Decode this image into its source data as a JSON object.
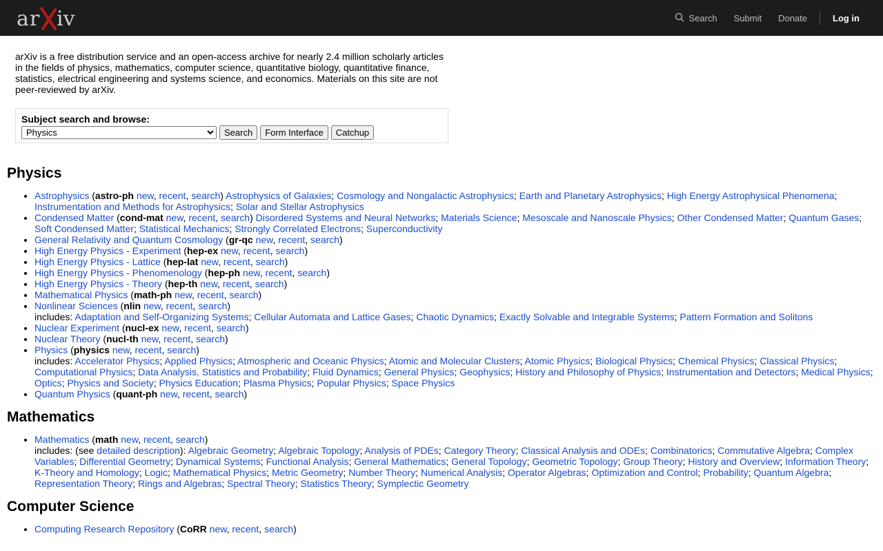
{
  "header": {
    "logo_text": "arXiv",
    "nav": {
      "search": "Search",
      "submit": "Submit",
      "donate": "Donate",
      "login": "Log in"
    }
  },
  "intro": "arXiv is a free distribution service and an open-access archive for nearly 2.4 million scholarly articles in the fields of physics, mathematics, computer science, quantitative biology, quantitative finance, statistics, electrical engineering and systems science, and economics. Materials on this site are not peer-reviewed by arXiv.",
  "search_box": {
    "label": "Subject search and browse:",
    "selected": "Physics",
    "buttons": {
      "search": "Search",
      "form": "Form Interface",
      "catchup": "Catchup"
    }
  },
  "common": {
    "new": "new",
    "recent": "recent",
    "search": "search",
    "includes": "includes: ",
    "see": "(see ",
    "detailed": "detailed description",
    "close_paren": "):"
  },
  "sections": {
    "physics": {
      "title": "Physics",
      "archives": [
        {
          "name": "Astrophysics",
          "code": "astro-ph",
          "subs": [
            "Astrophysics of Galaxies",
            "Cosmology and Nongalactic Astrophysics",
            "Earth and Planetary Astrophysics",
            "High Energy Astrophysical Phenomena",
            "Instrumentation and Methods for Astrophysics",
            "Solar and Stellar Astrophysics"
          ]
        },
        {
          "name": "Condensed Matter",
          "code": "cond-mat",
          "subs": [
            "Disordered Systems and Neural Networks",
            "Materials Science",
            "Mesoscale and Nanoscale Physics",
            "Other Condensed Matter",
            "Quantum Gases",
            "Soft Condensed Matter",
            "Statistical Mechanics",
            "Strongly Correlated Electrons",
            "Superconductivity"
          ]
        },
        {
          "name": "General Relativity and Quantum Cosmology",
          "code": "gr-qc",
          "subs": []
        },
        {
          "name": "High Energy Physics - Experiment",
          "code": "hep-ex",
          "subs": []
        },
        {
          "name": "High Energy Physics - Lattice",
          "code": "hep-lat",
          "subs": []
        },
        {
          "name": "High Energy Physics - Phenomenology",
          "code": "hep-ph",
          "subs": []
        },
        {
          "name": "High Energy Physics - Theory",
          "code": "hep-th",
          "subs": []
        },
        {
          "name": "Mathematical Physics",
          "code": "math-ph",
          "subs": []
        },
        {
          "name": "Nonlinear Sciences",
          "code": "nlin",
          "includes": [
            "Adaptation and Self-Organizing Systems",
            "Cellular Automata and Lattice Gases",
            "Chaotic Dynamics",
            "Exactly Solvable and Integrable Systems",
            "Pattern Formation and Solitons"
          ]
        },
        {
          "name": "Nuclear Experiment",
          "code": "nucl-ex",
          "subs": []
        },
        {
          "name": "Nuclear Theory",
          "code": "nucl-th",
          "subs": []
        },
        {
          "name": "Physics",
          "code": "physics",
          "includes": [
            "Accelerator Physics",
            "Applied Physics",
            "Atmospheric and Oceanic Physics",
            "Atomic and Molecular Clusters",
            "Atomic Physics",
            "Biological Physics",
            "Chemical Physics",
            "Classical Physics",
            "Computational Physics",
            "Data Analysis, Statistics and Probability",
            "Fluid Dynamics",
            "General Physics",
            "Geophysics",
            "History and Philosophy of Physics",
            "Instrumentation and Detectors",
            "Medical Physics",
            "Optics",
            "Physics and Society",
            "Physics Education",
            "Plasma Physics",
            "Popular Physics",
            "Space Physics"
          ]
        },
        {
          "name": "Quantum Physics",
          "code": "quant-ph",
          "subs": []
        }
      ]
    },
    "math": {
      "title": "Mathematics",
      "archives": [
        {
          "name": "Mathematics",
          "code": "math",
          "detailed": true,
          "includes": [
            "Algebraic Geometry",
            "Algebraic Topology",
            "Analysis of PDEs",
            "Category Theory",
            "Classical Analysis and ODEs",
            "Combinatorics",
            "Commutative Algebra",
            "Complex Variables",
            "Differential Geometry",
            "Dynamical Systems",
            "Functional Analysis",
            "General Mathematics",
            "General Topology",
            "Geometric Topology",
            "Group Theory",
            "History and Overview",
            "Information Theory",
            "K-Theory and Homology",
            "Logic",
            "Mathematical Physics",
            "Metric Geometry",
            "Number Theory",
            "Numerical Analysis",
            "Operator Algebras",
            "Optimization and Control",
            "Probability",
            "Quantum Algebra",
            "Representation Theory",
            "Rings and Algebras",
            "Spectral Theory",
            "Statistics Theory",
            "Symplectic Geometry"
          ]
        }
      ]
    },
    "cs": {
      "title": "Computer Science",
      "archives": [
        {
          "name": "Computing Research Repository",
          "code": "CoRR",
          "subs": []
        }
      ]
    }
  },
  "colors": {
    "header_bg": "#1c1c1c",
    "link": "#1a4dcc",
    "logo_x": "#b31b1b"
  }
}
